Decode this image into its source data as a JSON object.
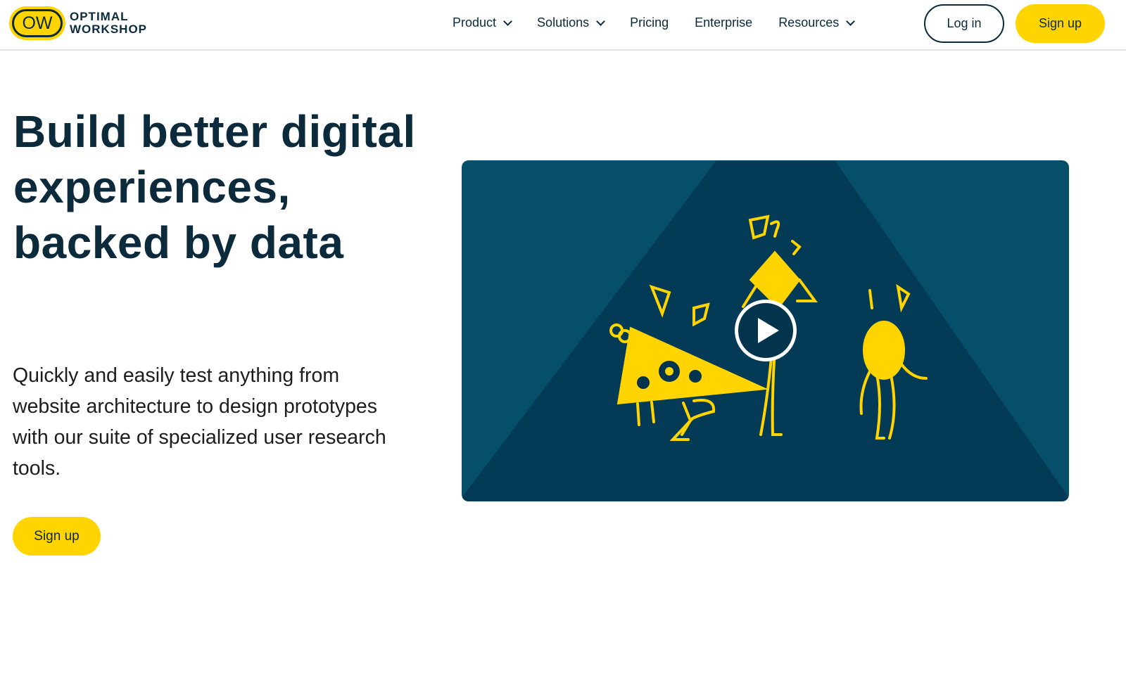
{
  "brand": {
    "badge": "OW",
    "line1": "OPTIMAL",
    "line2": "WORKSHOP"
  },
  "nav": {
    "items": [
      {
        "label": "Product",
        "dropdown": true
      },
      {
        "label": "Solutions",
        "dropdown": true
      },
      {
        "label": "Pricing",
        "dropdown": false
      },
      {
        "label": "Enterprise",
        "dropdown": false
      },
      {
        "label": "Resources",
        "dropdown": true
      }
    ],
    "login": "Log in",
    "signup": "Sign up"
  },
  "hero": {
    "title": "Build better digital experiences, backed by data",
    "lead": "Quickly and easily test anything from website architecture to design prototypes with our suite of specialized user research tools.",
    "cta": "Sign up"
  },
  "colors": {
    "accent": "#ffd400",
    "navy": "#0b2a3c",
    "video_bg": "#064f6b"
  }
}
